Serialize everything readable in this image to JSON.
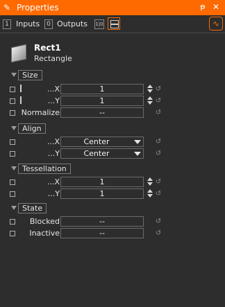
{
  "window": {
    "title": "Properties",
    "pin_glyph": "ᵽ",
    "close_glyph": "✕",
    "title_icon": "pencil-icon"
  },
  "toolbar": {
    "inputs_count": "1",
    "inputs_label": "Inputs",
    "outputs_count": "0",
    "outputs_label": "Outputs",
    "io_label": "1|0"
  },
  "object": {
    "name": "Rect1",
    "type": "Rectangle"
  },
  "sections": {
    "size": {
      "title": "Size"
    },
    "align": {
      "title": "Align"
    },
    "tessellation": {
      "title": "Tessellation"
    },
    "state": {
      "title": "State"
    }
  },
  "size": {
    "x_label": "...X",
    "x_value": "1",
    "y_label": "...Y",
    "y_value": "1",
    "normalize_label": "Normalize",
    "normalize_value": "--"
  },
  "align": {
    "x_label": "...X",
    "x_value": "Center",
    "y_label": "...Y",
    "y_value": "Center"
  },
  "tessellation": {
    "x_label": "...X",
    "x_value": "1",
    "y_label": "...Y",
    "y_value": "1"
  },
  "state": {
    "blocked_label": "Blocked",
    "blocked_value": "--",
    "inactive_label": "Inactive",
    "inactive_value": "--"
  },
  "colors": {
    "accent": "#ff6a00",
    "background": "#2d2d2d"
  }
}
